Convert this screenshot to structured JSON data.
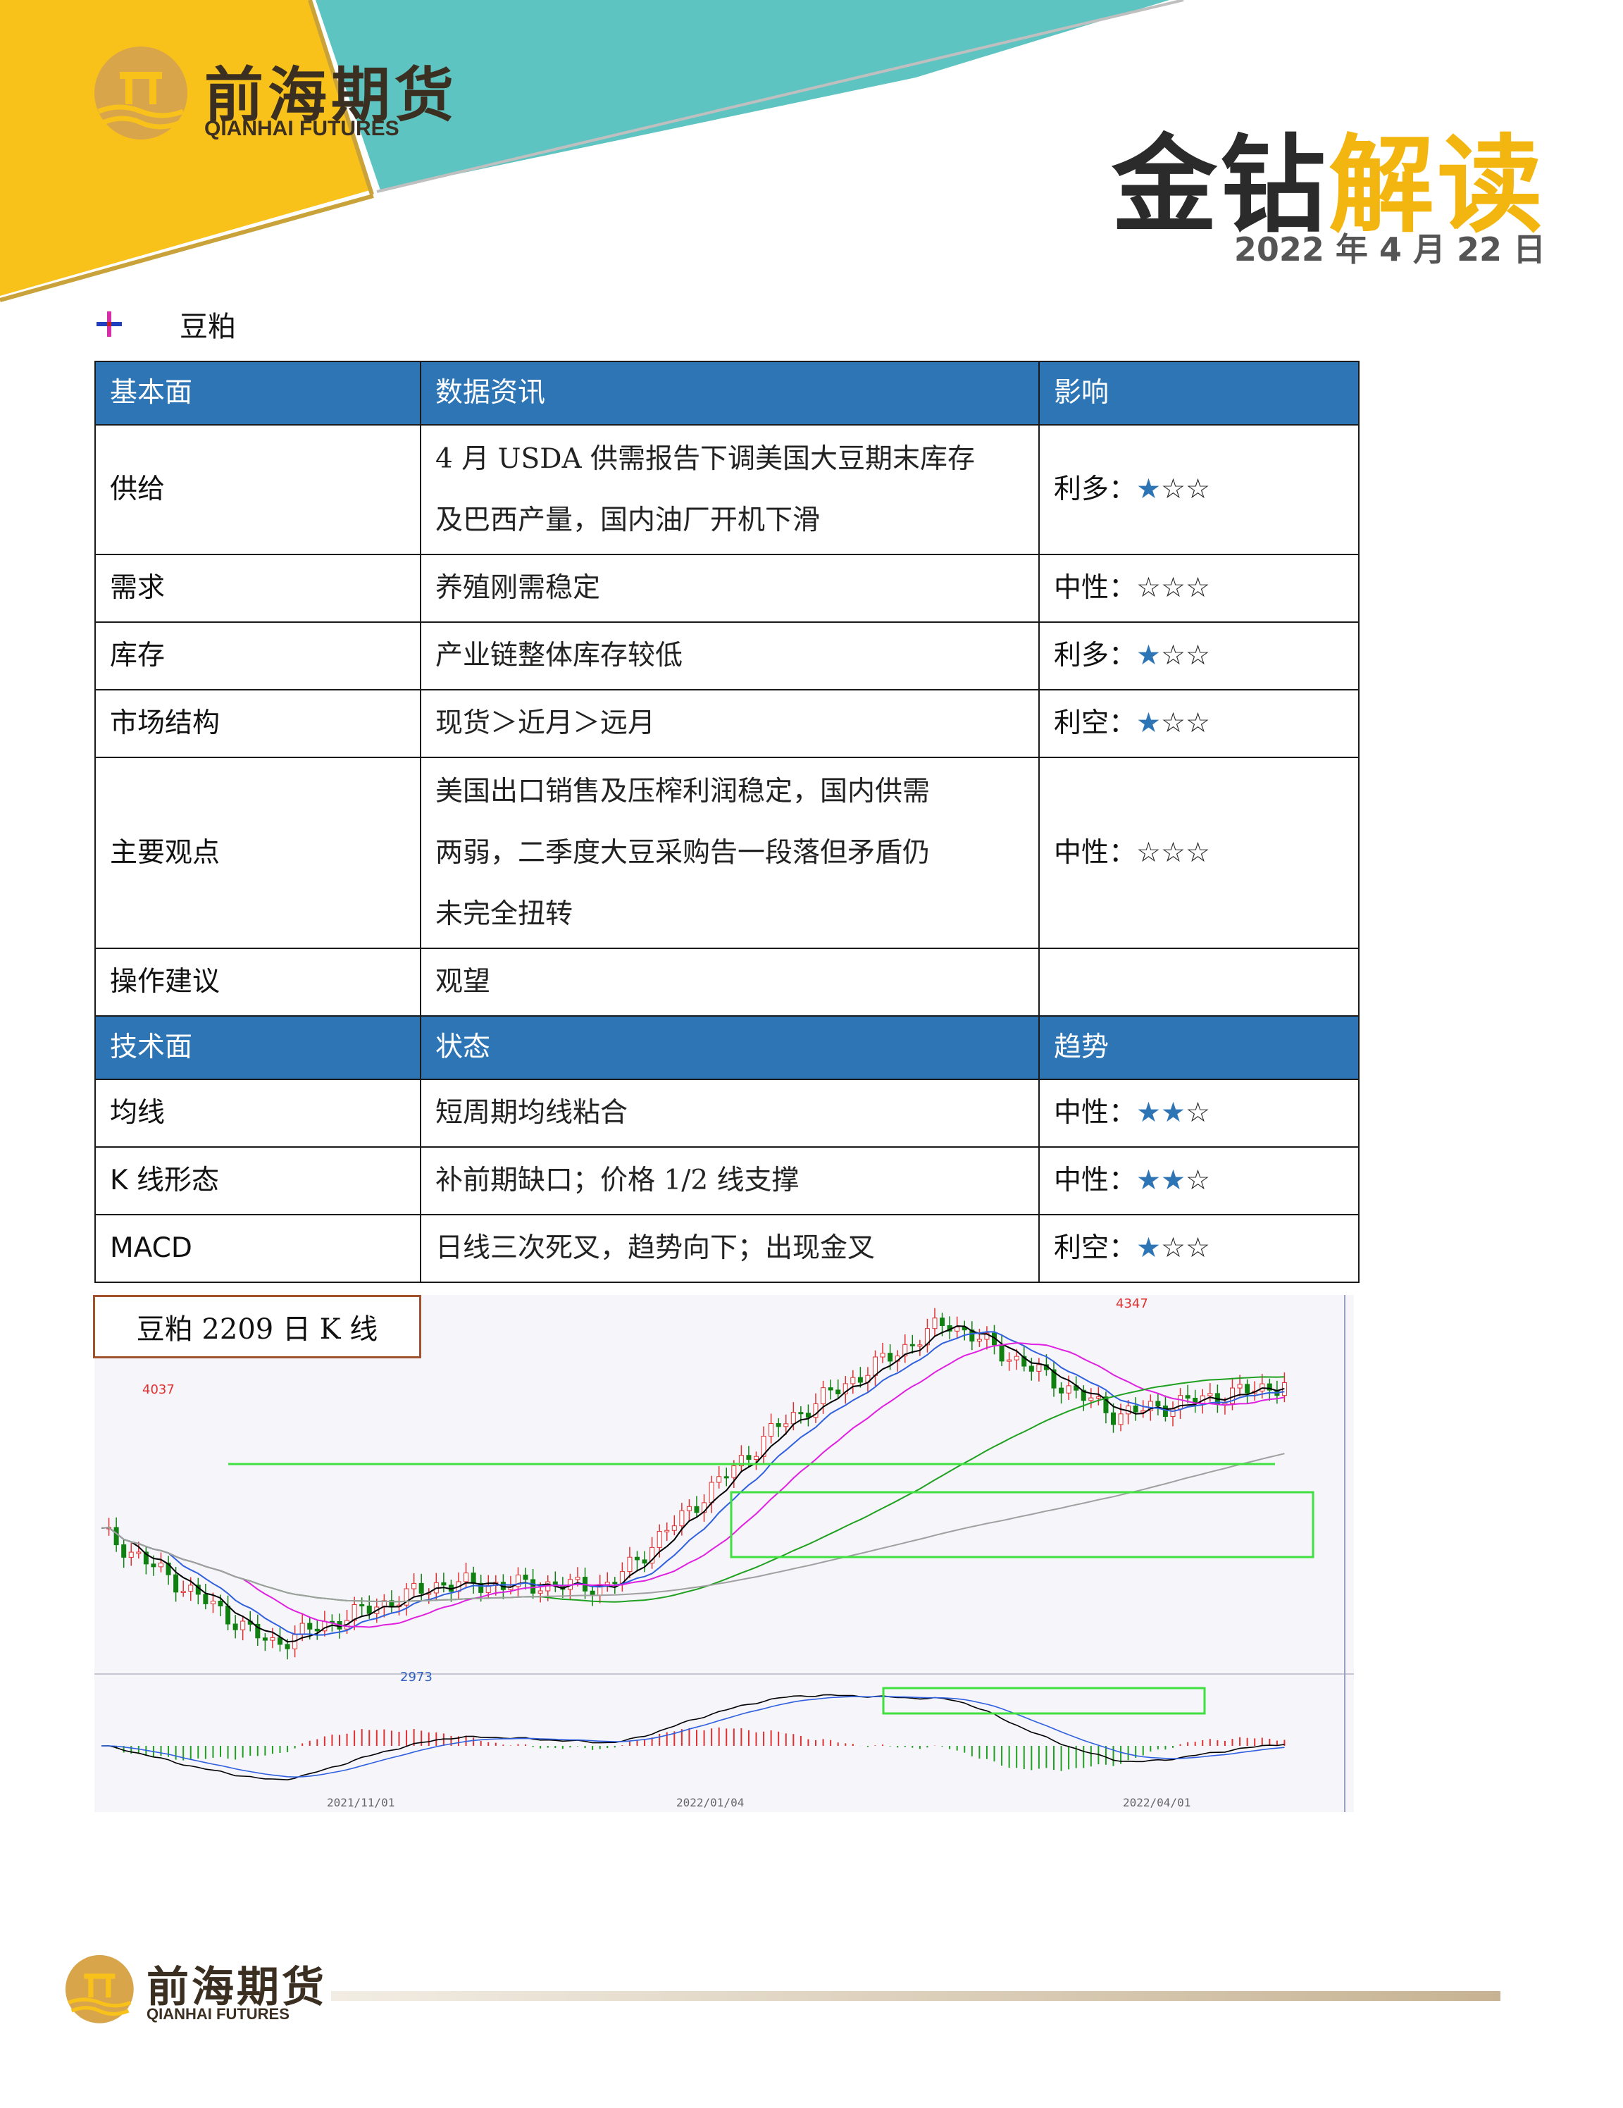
{
  "brand": {
    "logo_cn": "前海期货",
    "logo_en": "QIANHAI FUTURES",
    "title_dark": "金钻",
    "title_gold": "解读",
    "date": "2022 年 4 月 22 日"
  },
  "colors": {
    "yellow": "#f9c21a",
    "teal": "#5ec4c1",
    "gold": "#f3b611",
    "header_blue": "#2e75b6",
    "star_blue": "#2e75b6"
  },
  "section": {
    "name": "豆粕"
  },
  "table": {
    "header1": [
      "基本面",
      "数据资讯",
      "影响"
    ],
    "rows1": [
      {
        "label": "供给",
        "info_line1": "4 月 USDA 供需报告下调美国大豆期末库存",
        "info_line2": "及巴西产量，国内油厂开机下滑",
        "impact": "利多：",
        "stars_on": "★",
        "stars_off": "☆☆"
      },
      {
        "label": "需求",
        "info": "养殖刚需稳定",
        "impact": "中性：",
        "stars_on": "",
        "stars_off": "☆☆☆"
      },
      {
        "label": "库存",
        "info": "产业链整体库存较低",
        "impact": "利多：",
        "stars_on": "★",
        "stars_off": "☆☆"
      },
      {
        "label": "市场结构",
        "info": "现货＞近月＞远月",
        "impact": "利空：",
        "stars_on": "★",
        "stars_off": "☆☆"
      },
      {
        "label": "主要观点",
        "info_line1": "美国出口销售及压榨利润稳定，国内供需",
        "info_line2": "两弱，二季度大豆采购告一段落但矛盾仍",
        "info_line3": "未完全扭转",
        "impact": "中性：",
        "stars_on": "",
        "stars_off": "☆☆☆"
      },
      {
        "label": "操作建议",
        "info": "观望",
        "impact": ""
      }
    ],
    "header2": [
      "技术面",
      "状态",
      "趋势"
    ],
    "rows2": [
      {
        "label": "均线",
        "info": "短周期均线粘合",
        "impact": "中性：",
        "stars_on": "★★",
        "stars_off": "☆"
      },
      {
        "label": "K 线形态",
        "info": "补前期缺口；价格 1/2 线支撑",
        "impact": "中性：",
        "stars_on": "★★",
        "stars_off": "☆"
      },
      {
        "label": "MACD",
        "info": "日线三次死叉，趋势向下；出现金叉",
        "impact": "利空：",
        "stars_on": "★",
        "stars_off": "☆☆"
      }
    ]
  },
  "chart": {
    "label": "豆粕 2209 日 K 线",
    "high_label": "4347",
    "mid_label": "4037",
    "low_label": "2973",
    "dates": [
      "2021/11/01",
      "2022/01/04",
      "2022/04/01"
    ]
  },
  "chart_data": {
    "type": "line",
    "title": "豆粕 2209 日 K 线",
    "x": [
      "2021/11/01",
      "2022/01/04",
      "2022/04/01"
    ],
    "series": [
      {
        "values": [
          3450,
          2973,
          3230,
          3220,
          3900,
          4347,
          3950,
          4080
        ]
      }
    ],
    "annotations": [
      "4037",
      "4347",
      "2973"
    ],
    "ylim": [
      2900,
      4400
    ]
  }
}
